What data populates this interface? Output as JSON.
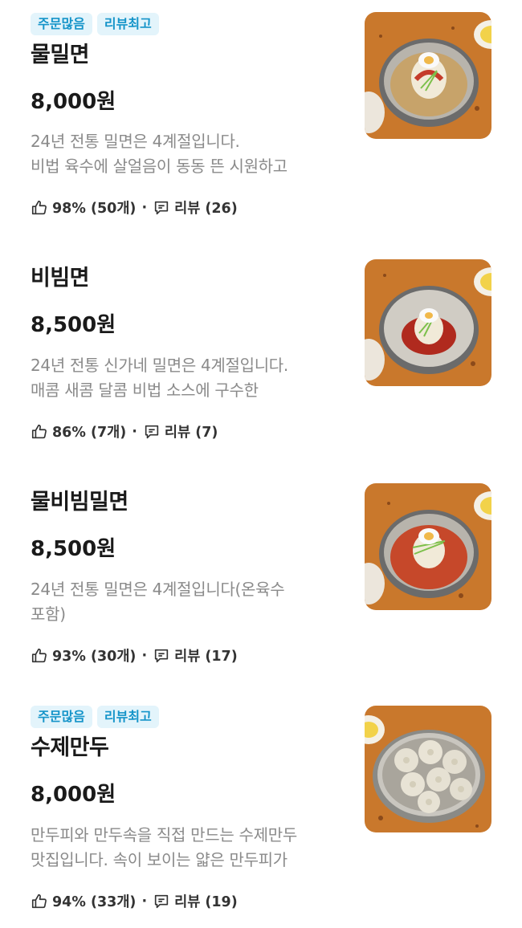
{
  "colors": {
    "badge_bg": "#e3f4fb",
    "badge_text": "#1594c9",
    "desc": "#8a8a8a",
    "table": "#c97a2c"
  },
  "menu": {
    "items": [
      {
        "badges": [
          "주문많음",
          "리뷰최고"
        ],
        "name": "물밀면",
        "price": "8,000원",
        "desc_lines": [
          "24년 전통 밀면은 4계절입니다.",
          "비법 육수에 살얼음이 동동 뜬 시원하고"
        ],
        "rating": "98% (50개)",
        "reviews": "리뷰 (26)",
        "image": "mul-milmyeon-photo"
      },
      {
        "badges": [],
        "name": "비빔면",
        "price": "8,500원",
        "desc_lines": [
          "24년 전통 신가네 밀면은 4계절입니다.",
          "매콤 새콤 달콤 비법 소스에 구수한"
        ],
        "rating": "86% (7개)",
        "reviews": "리뷰 (7)",
        "image": "bibim-myeon-photo"
      },
      {
        "badges": [],
        "name": "물비빔밀면",
        "price": "8,500원",
        "desc_lines": [
          "24년 전통 밀면은 4계절입니다(온육수",
          "포함)"
        ],
        "rating": "93% (30개)",
        "reviews": "리뷰 (17)",
        "image": "mulbibim-milmyeon-photo"
      },
      {
        "badges": [
          "주문많음",
          "리뷰최고"
        ],
        "name": "수제만두",
        "price": "8,000원",
        "desc_lines": [
          "만두피와 만두속을 직접 만드는 수제만두",
          "맛집입니다. 속이 보이는 얇은 만두피가"
        ],
        "rating": "94% (33개)",
        "reviews": "리뷰 (19)",
        "image": "handmade-mandu-photo"
      }
    ]
  }
}
